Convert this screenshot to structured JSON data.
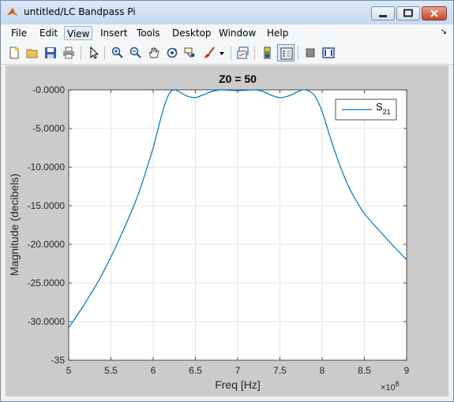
{
  "window": {
    "title": "untitled/LC Bandpass Pi"
  },
  "menu": {
    "items": [
      "File",
      "Edit",
      "View",
      "Insert",
      "Tools",
      "Desktop",
      "Window",
      "Help"
    ],
    "active": "View",
    "corner_icon": "dock-arrow-icon"
  },
  "toolbar": {
    "tools": [
      "new-figure-icon",
      "open-file-icon",
      "save-icon",
      "print-icon",
      "pointer-icon",
      "zoom-in-icon",
      "zoom-out-icon",
      "pan-icon",
      "rotate-3d-icon",
      "data-cursor-icon",
      "brush-icon",
      "brush-dropdown-icon",
      "link-plot-icon",
      "colorbar-icon",
      "legend-icon",
      "hide-plot-tools-icon",
      "show-plot-tools-icon"
    ],
    "pressed": "legend-icon"
  },
  "chart_data": {
    "type": "line",
    "title": "Z0 = 50",
    "xlabel": "Freq [Hz]",
    "ylabel": "Magnitude (decibels)",
    "x_multiplier": "×10",
    "x_exponent": "8",
    "xlim": [
      5,
      9
    ],
    "ylim": [
      -35,
      0
    ],
    "xticks": [
      5,
      5.5,
      6,
      6.5,
      7,
      7.5,
      8,
      8.5,
      9
    ],
    "xtick_labels": [
      "5",
      "5.5",
      "6",
      "6.5",
      "7",
      "7.5",
      "8",
      "8.5",
      "9"
    ],
    "yticks": [
      0,
      -5,
      -10,
      -15,
      -20,
      -25,
      -30,
      -35
    ],
    "ytick_labels": [
      "-0.0000",
      "-5.0000",
      "-10.0000",
      "-15.0000",
      "-20.0000",
      "-25.0000",
      "-30.0000",
      "-35"
    ],
    "grid": true,
    "legend_position": "top-right",
    "series": [
      {
        "name": "S",
        "name_sub": "21",
        "color": "#0072bd",
        "x": [
          5.0,
          5.2,
          5.4,
          5.6,
          5.8,
          5.9,
          6.0,
          6.05,
          6.1,
          6.15,
          6.2,
          6.25,
          6.3,
          6.4,
          6.5,
          6.6,
          6.7,
          6.8,
          6.9,
          7.0,
          7.1,
          7.2,
          7.3,
          7.4,
          7.5,
          7.6,
          7.7,
          7.75,
          7.8,
          7.85,
          7.9,
          7.95,
          8.0,
          8.05,
          8.1,
          8.2,
          8.3,
          8.4,
          8.5,
          8.6,
          8.8,
          9.0
        ],
        "y": [
          -30.8,
          -27.5,
          -23.8,
          -19.3,
          -14.2,
          -11.0,
          -7.5,
          -5.4,
          -3.3,
          -1.5,
          -0.3,
          0.0,
          -0.2,
          -0.8,
          -1.0,
          -0.6,
          -0.2,
          0.0,
          -0.05,
          -0.1,
          -0.05,
          0.0,
          -0.2,
          -0.7,
          -1.0,
          -0.8,
          -0.3,
          -0.05,
          0.0,
          -0.2,
          -0.6,
          -1.5,
          -2.8,
          -4.5,
          -6.3,
          -9.5,
          -12.2,
          -14.3,
          -16.0,
          -17.3,
          -19.7,
          -22.0
        ]
      }
    ]
  }
}
